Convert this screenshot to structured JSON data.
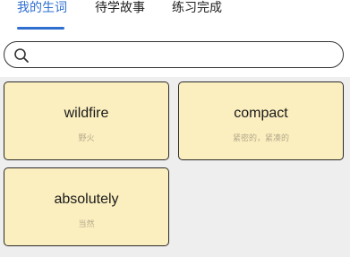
{
  "tabs": [
    {
      "label": "我的生词",
      "active": true
    },
    {
      "label": "待学故事",
      "active": false
    },
    {
      "label": "练习完成",
      "active": false
    }
  ],
  "search": {
    "value": "",
    "placeholder": ""
  },
  "cards": [
    {
      "word": "wildfire",
      "meaning": "野火"
    },
    {
      "word": "compact",
      "meaning": "紧密的，紧凑的"
    },
    {
      "word": "absolutely",
      "meaning": "当然"
    }
  ],
  "colors": {
    "accent": "#2f6fd0",
    "card_bg": "#fbeebf",
    "card_border": "#2a2a2a",
    "grid_bg": "#eeeeee",
    "meaning_text": "#b5aa8c"
  }
}
